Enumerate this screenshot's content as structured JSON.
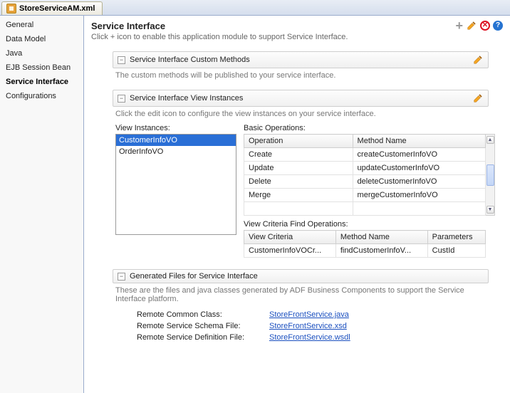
{
  "tab": {
    "label": "StoreServiceAM.xml"
  },
  "sidebar": {
    "items": [
      {
        "label": "General"
      },
      {
        "label": "Data Model"
      },
      {
        "label": "Java"
      },
      {
        "label": "EJB Session Bean"
      },
      {
        "label": "Service Interface"
      },
      {
        "label": "Configurations"
      }
    ]
  },
  "header": {
    "title": "Service Interface",
    "subtitle": "Click + icon to enable this application module to support Service Interface."
  },
  "sections": {
    "custom": {
      "title": "Service Interface Custom Methods",
      "desc": "The custom methods will be published to your service interface."
    },
    "views": {
      "title": "Service Interface View Instances",
      "desc": "Click the edit icon to configure the view instances on your service interface.",
      "viewInstancesLabel": "View Instances:",
      "basicOpsLabel": "Basic Operations:",
      "viewCritLabel": "View Criteria Find Operations:",
      "instances": [
        {
          "name": "CustomerInfoVO"
        },
        {
          "name": "OrderInfoVO"
        }
      ],
      "opsHeaders": {
        "op": "Operation",
        "mn": "Method Name"
      },
      "ops": [
        {
          "op": "Create",
          "mn": "createCustomerInfoVO"
        },
        {
          "op": "Update",
          "mn": "updateCustomerInfoVO"
        },
        {
          "op": "Delete",
          "mn": "deleteCustomerInfoVO"
        },
        {
          "op": "Merge",
          "mn": "mergeCustomerInfoVO"
        }
      ],
      "critHeaders": {
        "vc": "View Criteria",
        "mn": "Method Name",
        "pm": "Parameters"
      },
      "crits": [
        {
          "vc": "CustomerInfoVOCr...",
          "mn": "findCustomerInfoV...",
          "pm": "CustId"
        }
      ]
    },
    "gen": {
      "title": "Generated Files for Service Interface",
      "desc": "These are the files and java classes generated by ADF Business Components to support the Service Interface platform.",
      "rows": [
        {
          "k": "Remote Common Class:",
          "v": "StoreFrontService.java"
        },
        {
          "k": "Remote Service Schema File:",
          "v": "StoreFrontService.xsd"
        },
        {
          "k": "Remote Service Definition File:",
          "v": "StoreFrontService.wsdl"
        }
      ]
    }
  }
}
